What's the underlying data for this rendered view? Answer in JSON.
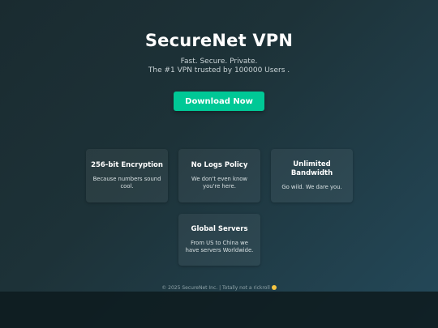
{
  "hero": {
    "title": "SecureNet VPN",
    "tagline_line1": "Fast. Secure. Private.",
    "tagline_line2": "The #1 VPN trusted by 100000 Users .",
    "cta_label": "Download Now",
    "cta_color": "#00c896"
  },
  "features": [
    {
      "title": "256-bit Encryption",
      "description": "Because numbers sound cool."
    },
    {
      "title": "No Logs Policy",
      "description": "We don't even know you're here."
    },
    {
      "title": "Unlimited Bandwidth",
      "description": "Go wild. We dare you."
    },
    {
      "title": "Global Servers",
      "description": "From US to China we have servers Worldwide."
    }
  ],
  "footer": {
    "text": "© 2025 SecureNet Inc. | Totally not a rickroll",
    "emoji": "smirk-emoji-icon"
  }
}
